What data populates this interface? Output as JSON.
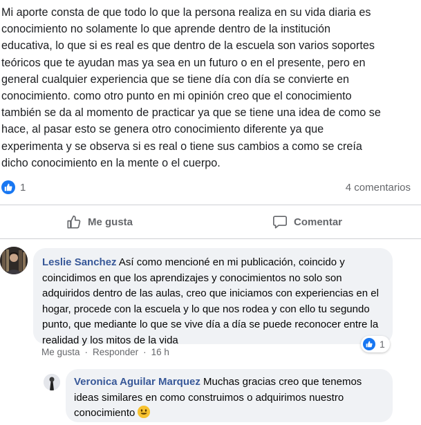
{
  "post": {
    "lines": [
      "Mi aporte consta de que todo lo que la persona realiza en su vida diaria es",
      "conocimiento no solamente lo que aprende dentro de la institución",
      "educativa, lo que si es real es que dentro de la escuela son varios soportes",
      "teóricos que te ayudan mas ya sea en un futuro o en el presente, pero en",
      "general cualquier experiencia que se tiene día con día se convierte en",
      "conocimiento. como otro punto en mi opinión creo que el conocimiento",
      "también se da al momento de practicar ya que se tiene una idea de como se",
      "hace, al pasar esto se genera otro conocimiento diferente ya que",
      "experimenta y se observa si es real o tiene sus cambios a como se creía",
      "dicho conocimiento en la mente o el cuerpo."
    ]
  },
  "stats": {
    "like_count": "1",
    "comments": "4 comentarios"
  },
  "actions": {
    "like_label": "Me gusta",
    "comment_label": "Comentar"
  },
  "comments": [
    {
      "author": "Leslie Sanchez",
      "text": " Así como mencioné en mi publicación, coincido y coincidimos en que los aprendizajes y conocimientos no solo son adquiridos dentro de las aulas, creo que iniciamos con experiencias en el hogar, procede con la escuela y lo que nos rodea y con ello tu segundo punto, que mediante lo que se vive día a día se puede reconocer entre la realidad y los mitos de la vida",
      "reaction_count": "1",
      "like_link": "Me gusta",
      "reply_link": "Responder",
      "time": "16 h"
    },
    {
      "author": "Veronica Aguilar Marquez",
      "text": " Muchas gracias creo que tenemos ideas similares en como construimos o adquirimos nuestro conocimiento"
    }
  ],
  "icons": {
    "like_badge": "thumbs-up-icon",
    "like_action": "thumbs-up-outline-icon",
    "comment_action": "speech-bubble-icon",
    "emoji": "smiley-emoji-icon"
  },
  "colors": {
    "accent": "#1877f2",
    "author": "#385898",
    "muted": "#65676b",
    "bubble": "#f0f2f5"
  }
}
